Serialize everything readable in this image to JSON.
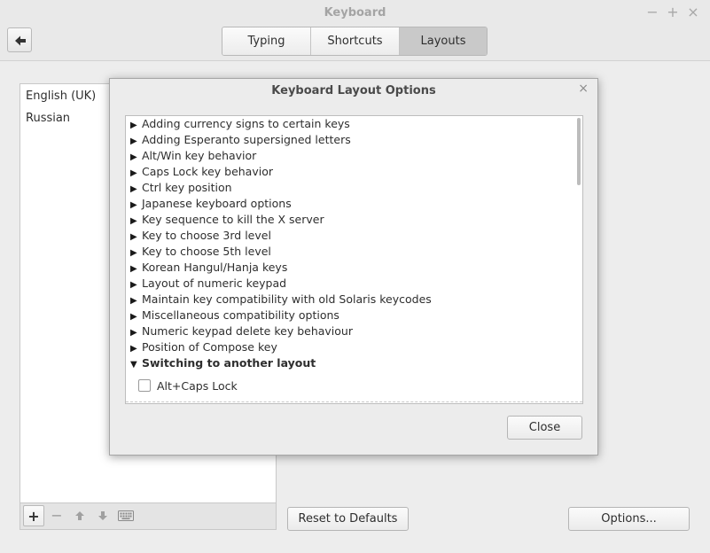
{
  "window": {
    "title": "Keyboard",
    "minimize": "−",
    "maximize": "+",
    "close": "×"
  },
  "tabs": [
    {
      "label": "Typing",
      "active": false
    },
    {
      "label": "Shortcuts",
      "active": false
    },
    {
      "label": "Layouts",
      "active": true
    }
  ],
  "layouts": {
    "items": [
      "English (UK)",
      "Russian"
    ]
  },
  "list_toolbar": {
    "add": "+",
    "remove": "−"
  },
  "buttons": {
    "reset": "Reset to Defaults",
    "options": "Options..."
  },
  "dialog": {
    "title": "Keyboard Layout Options",
    "close_x": "×",
    "close_button": "Close",
    "options": [
      "Adding currency signs to certain keys",
      "Adding Esperanto supersigned letters",
      "Alt/Win key behavior",
      "Caps Lock key behavior",
      "Ctrl key position",
      "Japanese keyboard options",
      "Key sequence to kill the X server",
      "Key to choose 3rd level",
      "Key to choose 5th level",
      "Korean Hangul/Hanja keys",
      "Layout of numeric keypad",
      "Maintain key compatibility with old Solaris keycodes",
      "Miscellaneous compatibility options",
      "Numeric keypad delete key behaviour",
      "Position of Compose key"
    ],
    "expanded": {
      "label": "Switching to another layout",
      "children": [
        {
          "label": "Alt+Caps Lock",
          "checked": false
        }
      ]
    }
  },
  "colors": {
    "background": "#ededed",
    "active_tab": "#c9c9c9",
    "text": "#2e2e2e"
  }
}
